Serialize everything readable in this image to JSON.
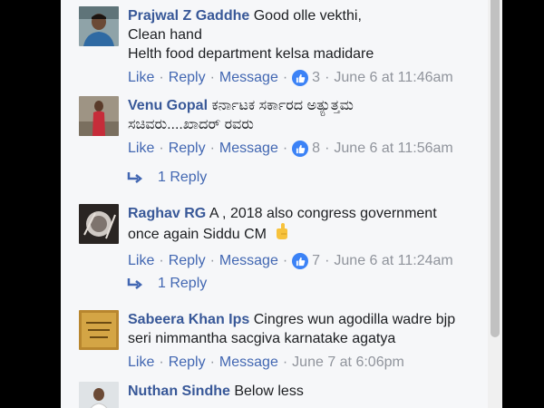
{
  "actions": {
    "like": "Like",
    "reply": "Reply",
    "message": "Message",
    "separator": "·"
  },
  "comments": [
    {
      "author": "Prajwal Z Gaddhe",
      "lines": [
        "Good olle vekthi,",
        "Clean hand",
        "Helth food department kelsa madidare"
      ],
      "reactions": "3",
      "timestamp": "June 6 at 11:46am"
    },
    {
      "author": "Venu Gopal",
      "lines": [
        "ಕರ್ನಾಟಕ ಸರ್ಕಾರದ ಅತ್ಯುತ್ತಮ",
        "ಸಚಿವರು....ಖಾದರ್ ರವರು"
      ],
      "reactions": "8",
      "timestamp": "June 6 at 11:56am",
      "replies": "1 Reply"
    },
    {
      "author": "Raghav RG",
      "lines": [
        "A , 2018 also congress government",
        "once again Siddu CM"
      ],
      "reactions": "7",
      "timestamp": "June 6 at 11:24am",
      "replies": "1 Reply"
    },
    {
      "author": "Sabeera Khan Ips",
      "lines": [
        "Cingres wun agodilla wadre bjp",
        "seri nimmantha sacgiva karnatake agatya"
      ],
      "timestamp": "June 7 at 6:06pm"
    },
    {
      "author": "Nuthan Sindhe",
      "lines": [
        "Below less"
      ]
    }
  ],
  "icons": {
    "like": "thumbs-up-icon",
    "reply_arrow": "reply-arrow-icon",
    "emoji": "pointing-hand-emoji"
  },
  "colors": {
    "author": "#385898",
    "link": "#4267b2",
    "meta": "#90949c",
    "background": "#f6f7f9",
    "like_badge": "#3b82f6"
  }
}
